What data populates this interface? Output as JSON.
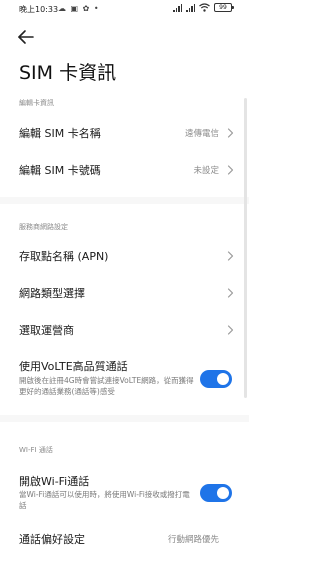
{
  "status_bar": {
    "time": "晚上10:33",
    "left_icons": "☁ ▣ ✿ •",
    "battery_level": "99",
    "icons": [
      "cloud-icon",
      "media-icon",
      "notification-icon",
      "dot-icon",
      "signal-icon",
      "wifi-icon",
      "battery-icon"
    ]
  },
  "header": {
    "back_icon": "back-arrow-icon",
    "title": "SIM 卡資訊"
  },
  "sections": {
    "edit_sim": {
      "header": "編輯卡資訊",
      "name_label": "編輯 SIM 卡名稱",
      "name_value": "遠傳電信",
      "number_label": "編輯 SIM 卡號碼",
      "number_value": "未設定"
    },
    "carrier": {
      "header": "服務商網路設定",
      "apn_label": "存取點名稱 (APN)",
      "network_type_label": "網路類型選擇",
      "operator_label": "選取運營商",
      "volte_label": "使用VoLTE高品質通話",
      "volte_desc": "開啟後在註冊4G時會嘗試連接VoLTE網路，從而獲得更好的通話業務(通話等)感受",
      "volte_enabled": true
    },
    "wifi_calling": {
      "header": "WI-FI 通話",
      "label": "開啟Wi-Fi通話",
      "desc": "當Wi-Fi通話可以使用時，將使用Wi-Fi接收或撥打電話",
      "enabled": true,
      "next_label": "通話偏好設定",
      "next_value": "行動網路優先"
    }
  },
  "colors": {
    "accent": "#1f74e8",
    "secondary_text": "#8a8a8a",
    "divider": "#f7f7f7"
  }
}
